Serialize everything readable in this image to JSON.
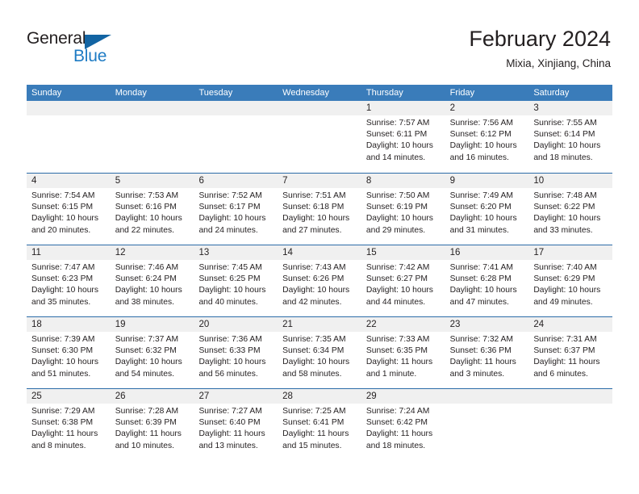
{
  "brand": {
    "name_part1": "General",
    "name_part2": "Blue",
    "accent_color": "#1e7bc4",
    "triangle_color": "#1264a3"
  },
  "header": {
    "title": "February 2024",
    "subtitle": "Mixia, Xinjiang, China"
  },
  "theme": {
    "header_row_bg": "#3a7cba",
    "row_divider": "#2c6ca8",
    "day_band_bg": "#f0f0f0",
    "text_color": "#231f20"
  },
  "calendar": {
    "weekday_headers": [
      "Sunday",
      "Monday",
      "Tuesday",
      "Wednesday",
      "Thursday",
      "Friday",
      "Saturday"
    ],
    "weeks": [
      [
        {
          "day": "",
          "sunrise": "",
          "sunset": "",
          "daylight_line1": "",
          "daylight_line2": ""
        },
        {
          "day": "",
          "sunrise": "",
          "sunset": "",
          "daylight_line1": "",
          "daylight_line2": ""
        },
        {
          "day": "",
          "sunrise": "",
          "sunset": "",
          "daylight_line1": "",
          "daylight_line2": ""
        },
        {
          "day": "",
          "sunrise": "",
          "sunset": "",
          "daylight_line1": "",
          "daylight_line2": ""
        },
        {
          "day": "1",
          "sunrise": "Sunrise: 7:57 AM",
          "sunset": "Sunset: 6:11 PM",
          "daylight_line1": "Daylight: 10 hours",
          "daylight_line2": "and 14 minutes."
        },
        {
          "day": "2",
          "sunrise": "Sunrise: 7:56 AM",
          "sunset": "Sunset: 6:12 PM",
          "daylight_line1": "Daylight: 10 hours",
          "daylight_line2": "and 16 minutes."
        },
        {
          "day": "3",
          "sunrise": "Sunrise: 7:55 AM",
          "sunset": "Sunset: 6:14 PM",
          "daylight_line1": "Daylight: 10 hours",
          "daylight_line2": "and 18 minutes."
        }
      ],
      [
        {
          "day": "4",
          "sunrise": "Sunrise: 7:54 AM",
          "sunset": "Sunset: 6:15 PM",
          "daylight_line1": "Daylight: 10 hours",
          "daylight_line2": "and 20 minutes."
        },
        {
          "day": "5",
          "sunrise": "Sunrise: 7:53 AM",
          "sunset": "Sunset: 6:16 PM",
          "daylight_line1": "Daylight: 10 hours",
          "daylight_line2": "and 22 minutes."
        },
        {
          "day": "6",
          "sunrise": "Sunrise: 7:52 AM",
          "sunset": "Sunset: 6:17 PM",
          "daylight_line1": "Daylight: 10 hours",
          "daylight_line2": "and 24 minutes."
        },
        {
          "day": "7",
          "sunrise": "Sunrise: 7:51 AM",
          "sunset": "Sunset: 6:18 PM",
          "daylight_line1": "Daylight: 10 hours",
          "daylight_line2": "and 27 minutes."
        },
        {
          "day": "8",
          "sunrise": "Sunrise: 7:50 AM",
          "sunset": "Sunset: 6:19 PM",
          "daylight_line1": "Daylight: 10 hours",
          "daylight_line2": "and 29 minutes."
        },
        {
          "day": "9",
          "sunrise": "Sunrise: 7:49 AM",
          "sunset": "Sunset: 6:20 PM",
          "daylight_line1": "Daylight: 10 hours",
          "daylight_line2": "and 31 minutes."
        },
        {
          "day": "10",
          "sunrise": "Sunrise: 7:48 AM",
          "sunset": "Sunset: 6:22 PM",
          "daylight_line1": "Daylight: 10 hours",
          "daylight_line2": "and 33 minutes."
        }
      ],
      [
        {
          "day": "11",
          "sunrise": "Sunrise: 7:47 AM",
          "sunset": "Sunset: 6:23 PM",
          "daylight_line1": "Daylight: 10 hours",
          "daylight_line2": "and 35 minutes."
        },
        {
          "day": "12",
          "sunrise": "Sunrise: 7:46 AM",
          "sunset": "Sunset: 6:24 PM",
          "daylight_line1": "Daylight: 10 hours",
          "daylight_line2": "and 38 minutes."
        },
        {
          "day": "13",
          "sunrise": "Sunrise: 7:45 AM",
          "sunset": "Sunset: 6:25 PM",
          "daylight_line1": "Daylight: 10 hours",
          "daylight_line2": "and 40 minutes."
        },
        {
          "day": "14",
          "sunrise": "Sunrise: 7:43 AM",
          "sunset": "Sunset: 6:26 PM",
          "daylight_line1": "Daylight: 10 hours",
          "daylight_line2": "and 42 minutes."
        },
        {
          "day": "15",
          "sunrise": "Sunrise: 7:42 AM",
          "sunset": "Sunset: 6:27 PM",
          "daylight_line1": "Daylight: 10 hours",
          "daylight_line2": "and 44 minutes."
        },
        {
          "day": "16",
          "sunrise": "Sunrise: 7:41 AM",
          "sunset": "Sunset: 6:28 PM",
          "daylight_line1": "Daylight: 10 hours",
          "daylight_line2": "and 47 minutes."
        },
        {
          "day": "17",
          "sunrise": "Sunrise: 7:40 AM",
          "sunset": "Sunset: 6:29 PM",
          "daylight_line1": "Daylight: 10 hours",
          "daylight_line2": "and 49 minutes."
        }
      ],
      [
        {
          "day": "18",
          "sunrise": "Sunrise: 7:39 AM",
          "sunset": "Sunset: 6:30 PM",
          "daylight_line1": "Daylight: 10 hours",
          "daylight_line2": "and 51 minutes."
        },
        {
          "day": "19",
          "sunrise": "Sunrise: 7:37 AM",
          "sunset": "Sunset: 6:32 PM",
          "daylight_line1": "Daylight: 10 hours",
          "daylight_line2": "and 54 minutes."
        },
        {
          "day": "20",
          "sunrise": "Sunrise: 7:36 AM",
          "sunset": "Sunset: 6:33 PM",
          "daylight_line1": "Daylight: 10 hours",
          "daylight_line2": "and 56 minutes."
        },
        {
          "day": "21",
          "sunrise": "Sunrise: 7:35 AM",
          "sunset": "Sunset: 6:34 PM",
          "daylight_line1": "Daylight: 10 hours",
          "daylight_line2": "and 58 minutes."
        },
        {
          "day": "22",
          "sunrise": "Sunrise: 7:33 AM",
          "sunset": "Sunset: 6:35 PM",
          "daylight_line1": "Daylight: 11 hours",
          "daylight_line2": "and 1 minute."
        },
        {
          "day": "23",
          "sunrise": "Sunrise: 7:32 AM",
          "sunset": "Sunset: 6:36 PM",
          "daylight_line1": "Daylight: 11 hours",
          "daylight_line2": "and 3 minutes."
        },
        {
          "day": "24",
          "sunrise": "Sunrise: 7:31 AM",
          "sunset": "Sunset: 6:37 PM",
          "daylight_line1": "Daylight: 11 hours",
          "daylight_line2": "and 6 minutes."
        }
      ],
      [
        {
          "day": "25",
          "sunrise": "Sunrise: 7:29 AM",
          "sunset": "Sunset: 6:38 PM",
          "daylight_line1": "Daylight: 11 hours",
          "daylight_line2": "and 8 minutes."
        },
        {
          "day": "26",
          "sunrise": "Sunrise: 7:28 AM",
          "sunset": "Sunset: 6:39 PM",
          "daylight_line1": "Daylight: 11 hours",
          "daylight_line2": "and 10 minutes."
        },
        {
          "day": "27",
          "sunrise": "Sunrise: 7:27 AM",
          "sunset": "Sunset: 6:40 PM",
          "daylight_line1": "Daylight: 11 hours",
          "daylight_line2": "and 13 minutes."
        },
        {
          "day": "28",
          "sunrise": "Sunrise: 7:25 AM",
          "sunset": "Sunset: 6:41 PM",
          "daylight_line1": "Daylight: 11 hours",
          "daylight_line2": "and 15 minutes."
        },
        {
          "day": "29",
          "sunrise": "Sunrise: 7:24 AM",
          "sunset": "Sunset: 6:42 PM",
          "daylight_line1": "Daylight: 11 hours",
          "daylight_line2": "and 18 minutes."
        },
        {
          "day": "",
          "sunrise": "",
          "sunset": "",
          "daylight_line1": "",
          "daylight_line2": ""
        },
        {
          "day": "",
          "sunrise": "",
          "sunset": "",
          "daylight_line1": "",
          "daylight_line2": ""
        }
      ]
    ]
  }
}
